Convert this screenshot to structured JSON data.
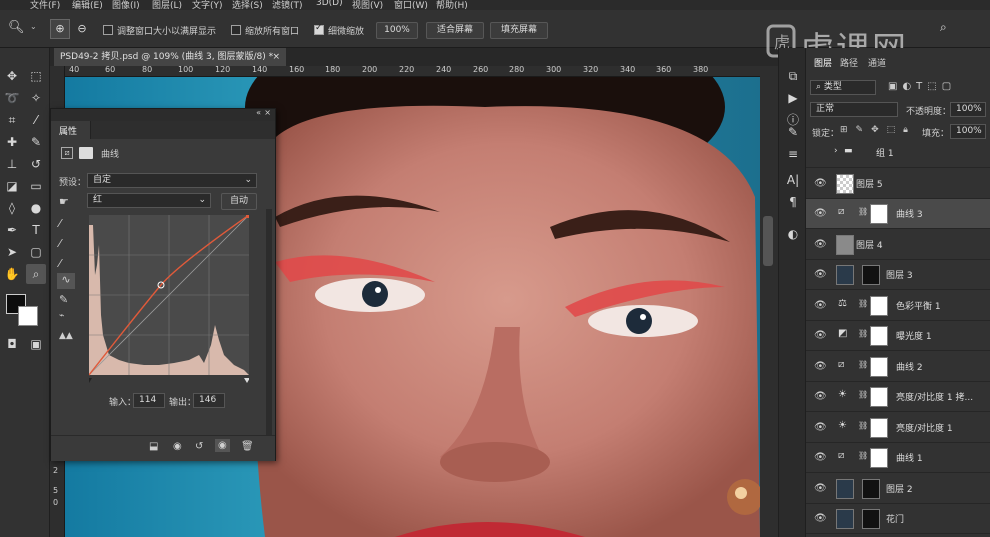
{
  "menu": [
    "文件(F)",
    "编辑(E)",
    "图像(I)",
    "图层(L)",
    "文字(Y)",
    "选择(S)",
    "滤镜(T)",
    "3D(D)",
    "视图(V)",
    "窗口(W)",
    "帮助(H)"
  ],
  "options": {
    "resize_windows": "调整窗口大小以满屏显示",
    "zoom_all": "缩放所有窗口",
    "scrubby_zoom": "细微缩放",
    "zoom_value": "100%",
    "fit_screen": "适合屏幕",
    "fill_screen": "填充屏幕"
  },
  "doc_tab": {
    "title": "PSD49-2 拷贝.psd @ 109% (曲线 3, 图层蒙版/8) *",
    "close": "×"
  },
  "ruler": {
    "h": [
      "40",
      "60",
      "80",
      "100",
      "120",
      "140",
      "160",
      "180",
      "200",
      "220",
      "240",
      "260",
      "280",
      "300",
      "320",
      "340",
      "360",
      "380"
    ],
    "v": [
      "2",
      "5",
      "0"
    ]
  },
  "watermark": "虎课网",
  "properties": {
    "panel_title": "属性",
    "header_label": "曲线",
    "preset_label": "预设：",
    "preset_value": "自定",
    "channel_value": "红",
    "auto_button": "自动",
    "input_label": "输入：",
    "input_value": "114",
    "output_label": "输出：",
    "output_value": "146"
  },
  "layers_panel": {
    "tabs": [
      "图层",
      "路径",
      "通道"
    ],
    "filter": "类型",
    "blend_mode": "正常",
    "opacity_label": "不透明度：",
    "opacity_value": "100%",
    "lock_label": "锁定：",
    "fill_label": "填充：",
    "fill_value": "100%",
    "layers": [
      {
        "name": "组 1",
        "type": "group"
      },
      {
        "name": "图层 5",
        "type": "pixel"
      },
      {
        "name": "曲线 3",
        "type": "curves",
        "selected": true
      },
      {
        "name": "图层 4",
        "type": "pixel"
      },
      {
        "name": "图层 3",
        "type": "pixel"
      },
      {
        "name": "色彩平衡 1",
        "type": "balance"
      },
      {
        "name": "曝光度 1",
        "type": "exposure"
      },
      {
        "name": "曲线 2",
        "type": "curves"
      },
      {
        "name": "亮度/对比度 1 拷...",
        "type": "brightness"
      },
      {
        "name": "亮度/对比度 1",
        "type": "brightness"
      },
      {
        "name": "曲线 1",
        "type": "curves"
      },
      {
        "name": "图层 2",
        "type": "pixel"
      },
      {
        "name": "花门",
        "type": "pixel"
      }
    ]
  },
  "colors": {
    "accent_curve": "#e05a3a",
    "canvas_bg": "#1e7fa6",
    "skin": "#c8857a"
  }
}
